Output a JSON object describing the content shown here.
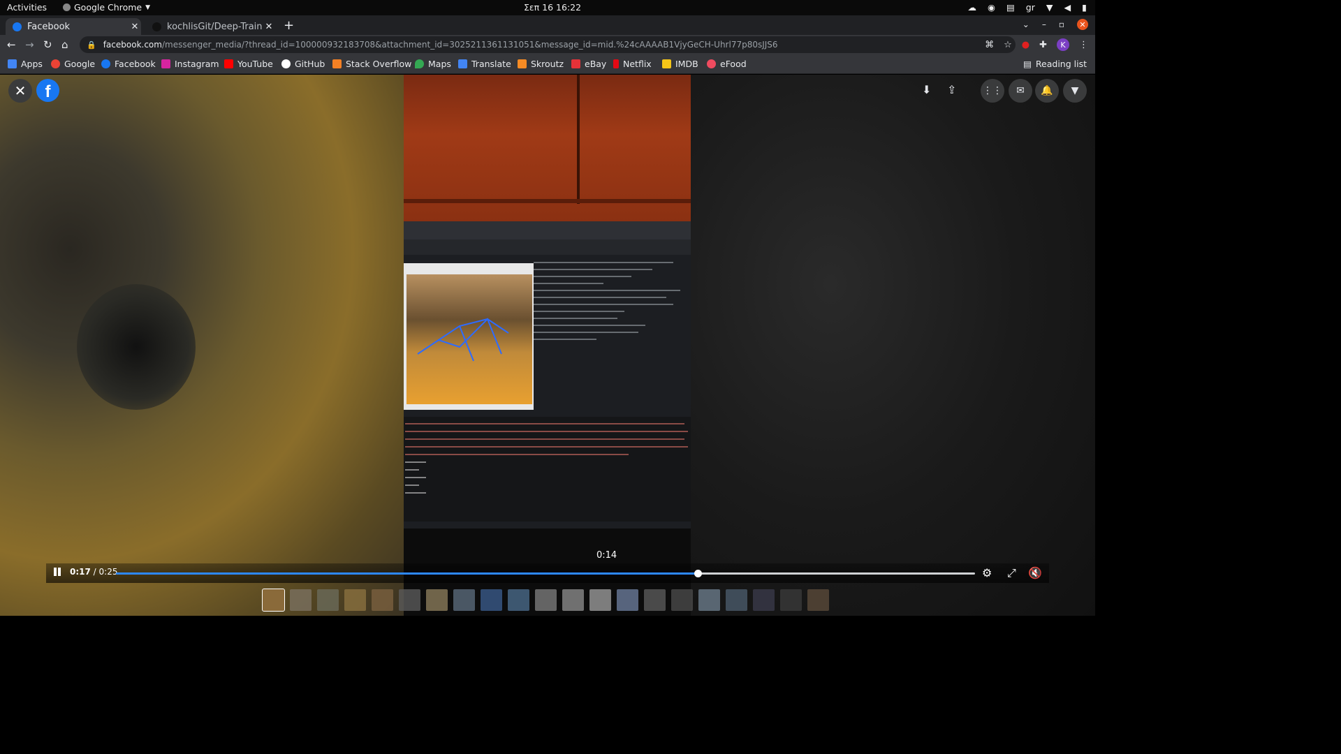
{
  "os_bar": {
    "activities": "Activities",
    "app_name": "Google Chrome",
    "clock": "Σεπ 16  16:22",
    "keyboard_layout": "gr"
  },
  "tabs": [
    {
      "title": "Facebook",
      "active": true,
      "icon": "facebook-icon"
    },
    {
      "title": "kochlisGit/Deep-Trainer: I",
      "active": false,
      "icon": "github-icon"
    }
  ],
  "address": {
    "host": "facebook.com",
    "path": "/messenger_media/?thread_id=100000932183708&attachment_id=3025211361131051&message_id=mid.%24cAAAAB1VjyGeCH-Uhrl77p80sJJS6"
  },
  "profile_initial": "K",
  "bookmarks": [
    {
      "label": "Apps",
      "icon": "apps-grid-icon",
      "color": "#4285f4"
    },
    {
      "label": "Google",
      "icon": "google-icon",
      "color": "#ea4335"
    },
    {
      "label": "Facebook",
      "icon": "facebook-icon",
      "color": "#1877f2"
    },
    {
      "label": "Instagram",
      "icon": "instagram-icon",
      "color": "#d6249f"
    },
    {
      "label": "YouTube",
      "icon": "youtube-icon",
      "color": "#ff0000"
    },
    {
      "label": "GitHub",
      "icon": "github-icon",
      "color": "#ffffff"
    },
    {
      "label": "Stack Overflow",
      "icon": "stackoverflow-icon",
      "color": "#f48024"
    },
    {
      "label": "Maps",
      "icon": "maps-pin-icon",
      "color": "#34a853"
    },
    {
      "label": "Translate",
      "icon": "translate-icon",
      "color": "#4285f4"
    },
    {
      "label": "Skroutz",
      "icon": "skroutz-icon",
      "color": "#f68b24"
    },
    {
      "label": "eBay",
      "icon": "ebay-icon",
      "color": "#e53238"
    },
    {
      "label": "Netflix",
      "icon": "netflix-icon",
      "color": "#e50914"
    },
    {
      "label": "IMDB",
      "icon": "imdb-icon",
      "color": "#f5c518"
    },
    {
      "label": "eFood",
      "icon": "efood-icon",
      "color": "#ef4b5f"
    }
  ],
  "reading_list": "Reading list",
  "player": {
    "current_time": "0:17",
    "separator": " / ",
    "duration": "0:25",
    "hover_time": "0:14",
    "progress": 0.677,
    "accent": "#2d88ff"
  },
  "thumbnail_count": 21
}
